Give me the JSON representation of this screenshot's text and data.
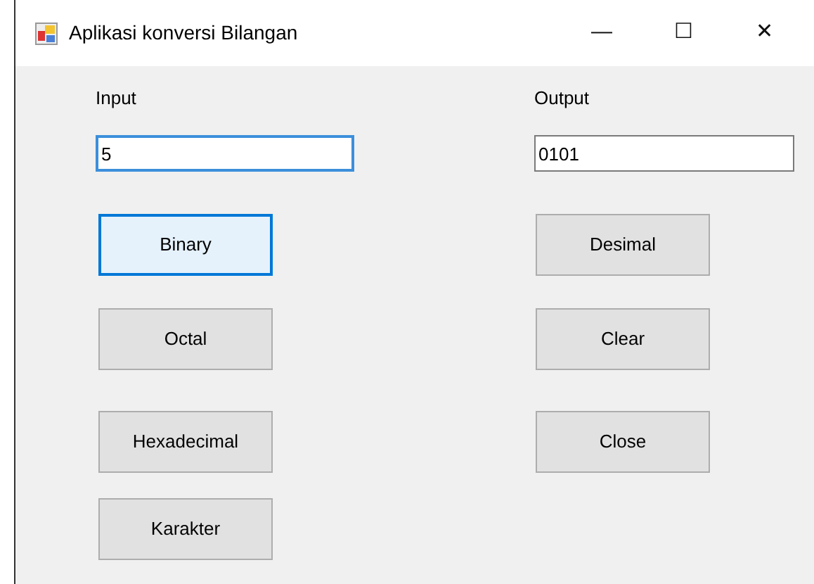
{
  "window": {
    "title": "Aplikasi konversi Bilangan",
    "controls": [
      "—",
      "☐",
      "✕"
    ]
  },
  "columns": [
    {
      "label": "Input",
      "field": {
        "value": "5",
        "focused": true
      },
      "buttons": [
        {
          "label": "Binary",
          "focused": true
        },
        {
          "label": "Octal",
          "focused": false
        },
        {
          "label": "Hexadecimal",
          "focused": false
        },
        {
          "label": "Karakter",
          "focused": false
        }
      ]
    },
    {
      "label": "Output",
      "field": {
        "value": "0101",
        "focused": false
      },
      "buttons": [
        {
          "label": "Desimal",
          "focused": false
        },
        {
          "label": "Clear",
          "focused": false
        },
        {
          "label": "Close",
          "focused": false
        }
      ]
    }
  ]
}
